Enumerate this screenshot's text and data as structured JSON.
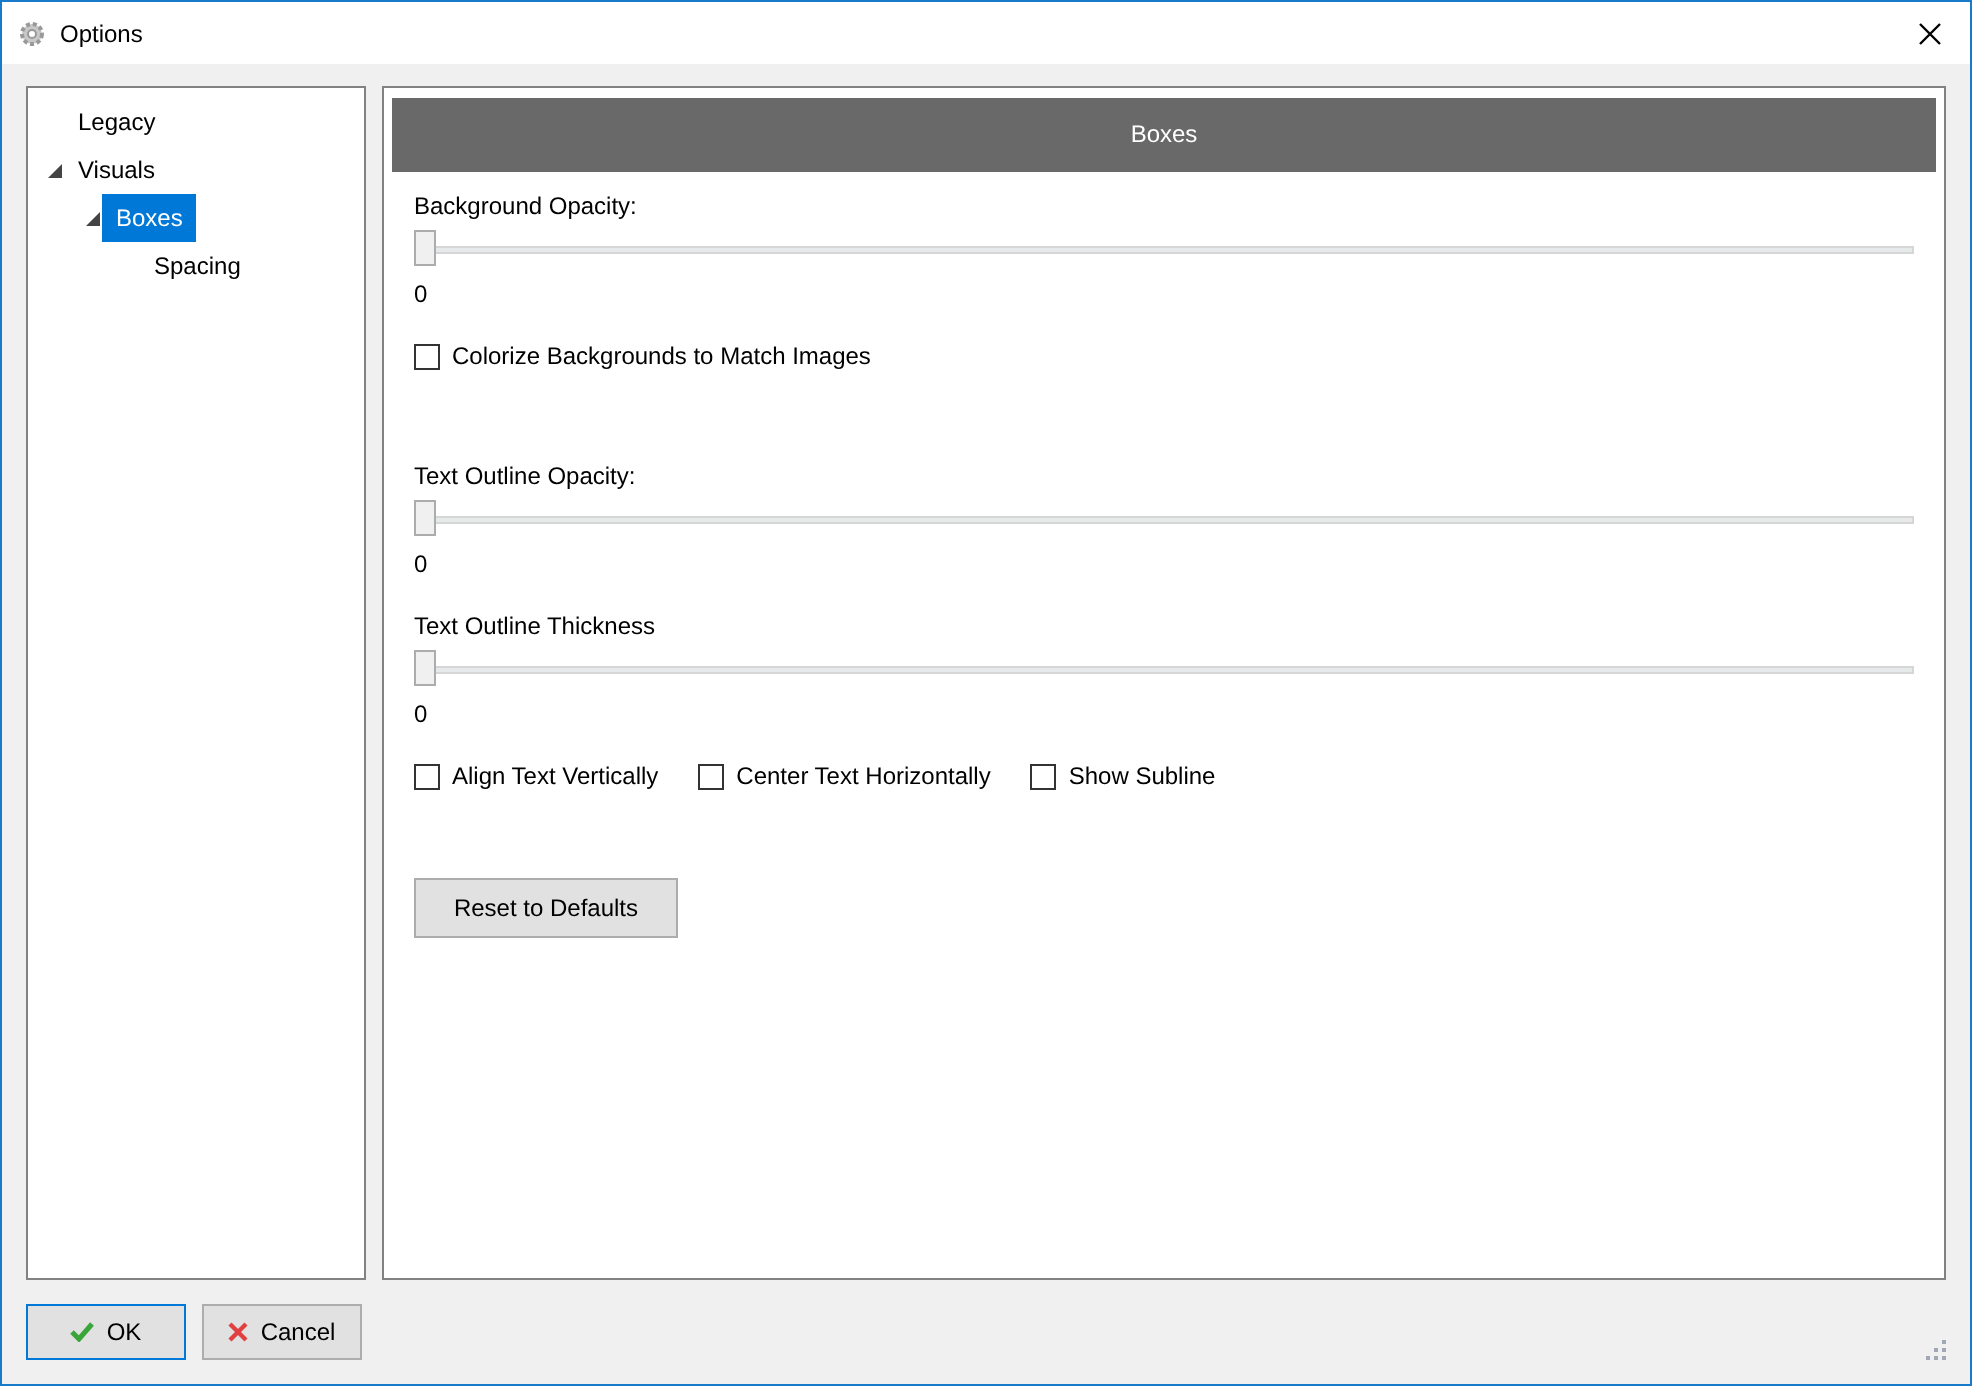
{
  "window": {
    "title": "Options"
  },
  "tree": [
    {
      "label": "Legacy",
      "selected": false
    },
    {
      "label": "Visuals",
      "selected": false,
      "expanded": true,
      "children": [
        {
          "label": "Boxes",
          "selected": true,
          "expanded": true,
          "children": [
            {
              "label": "Spacing",
              "selected": false
            }
          ]
        }
      ]
    }
  ],
  "panel": {
    "title": "Boxes",
    "controls": [
      {
        "kind": "slider",
        "label": "Background Opacity:",
        "level": 0,
        "reading": "0"
      },
      {
        "kind": "checkboxes",
        "items": [
          {
            "label": "Colorize Backgrounds to Match Images",
            "checked": false
          }
        ]
      },
      {
        "kind": "slider",
        "label": "Text Outline Opacity:",
        "level": 0,
        "reading": "0"
      },
      {
        "kind": "slider",
        "label": "Text Outline Thickness",
        "level": 0,
        "reading": "0"
      },
      {
        "kind": "checkboxes",
        "items": [
          {
            "label": "Align Text Vertically",
            "checked": false
          },
          {
            "label": "Center Text Horizontally",
            "checked": false
          },
          {
            "label": "Show Subline",
            "checked": false
          }
        ]
      },
      {
        "kind": "button",
        "label": "Reset to Defaults"
      }
    ]
  },
  "buttons": [
    {
      "kind": "ok",
      "label": "OK",
      "default": true
    },
    {
      "kind": "cancel",
      "label": "Cancel",
      "default": false
    }
  ]
}
